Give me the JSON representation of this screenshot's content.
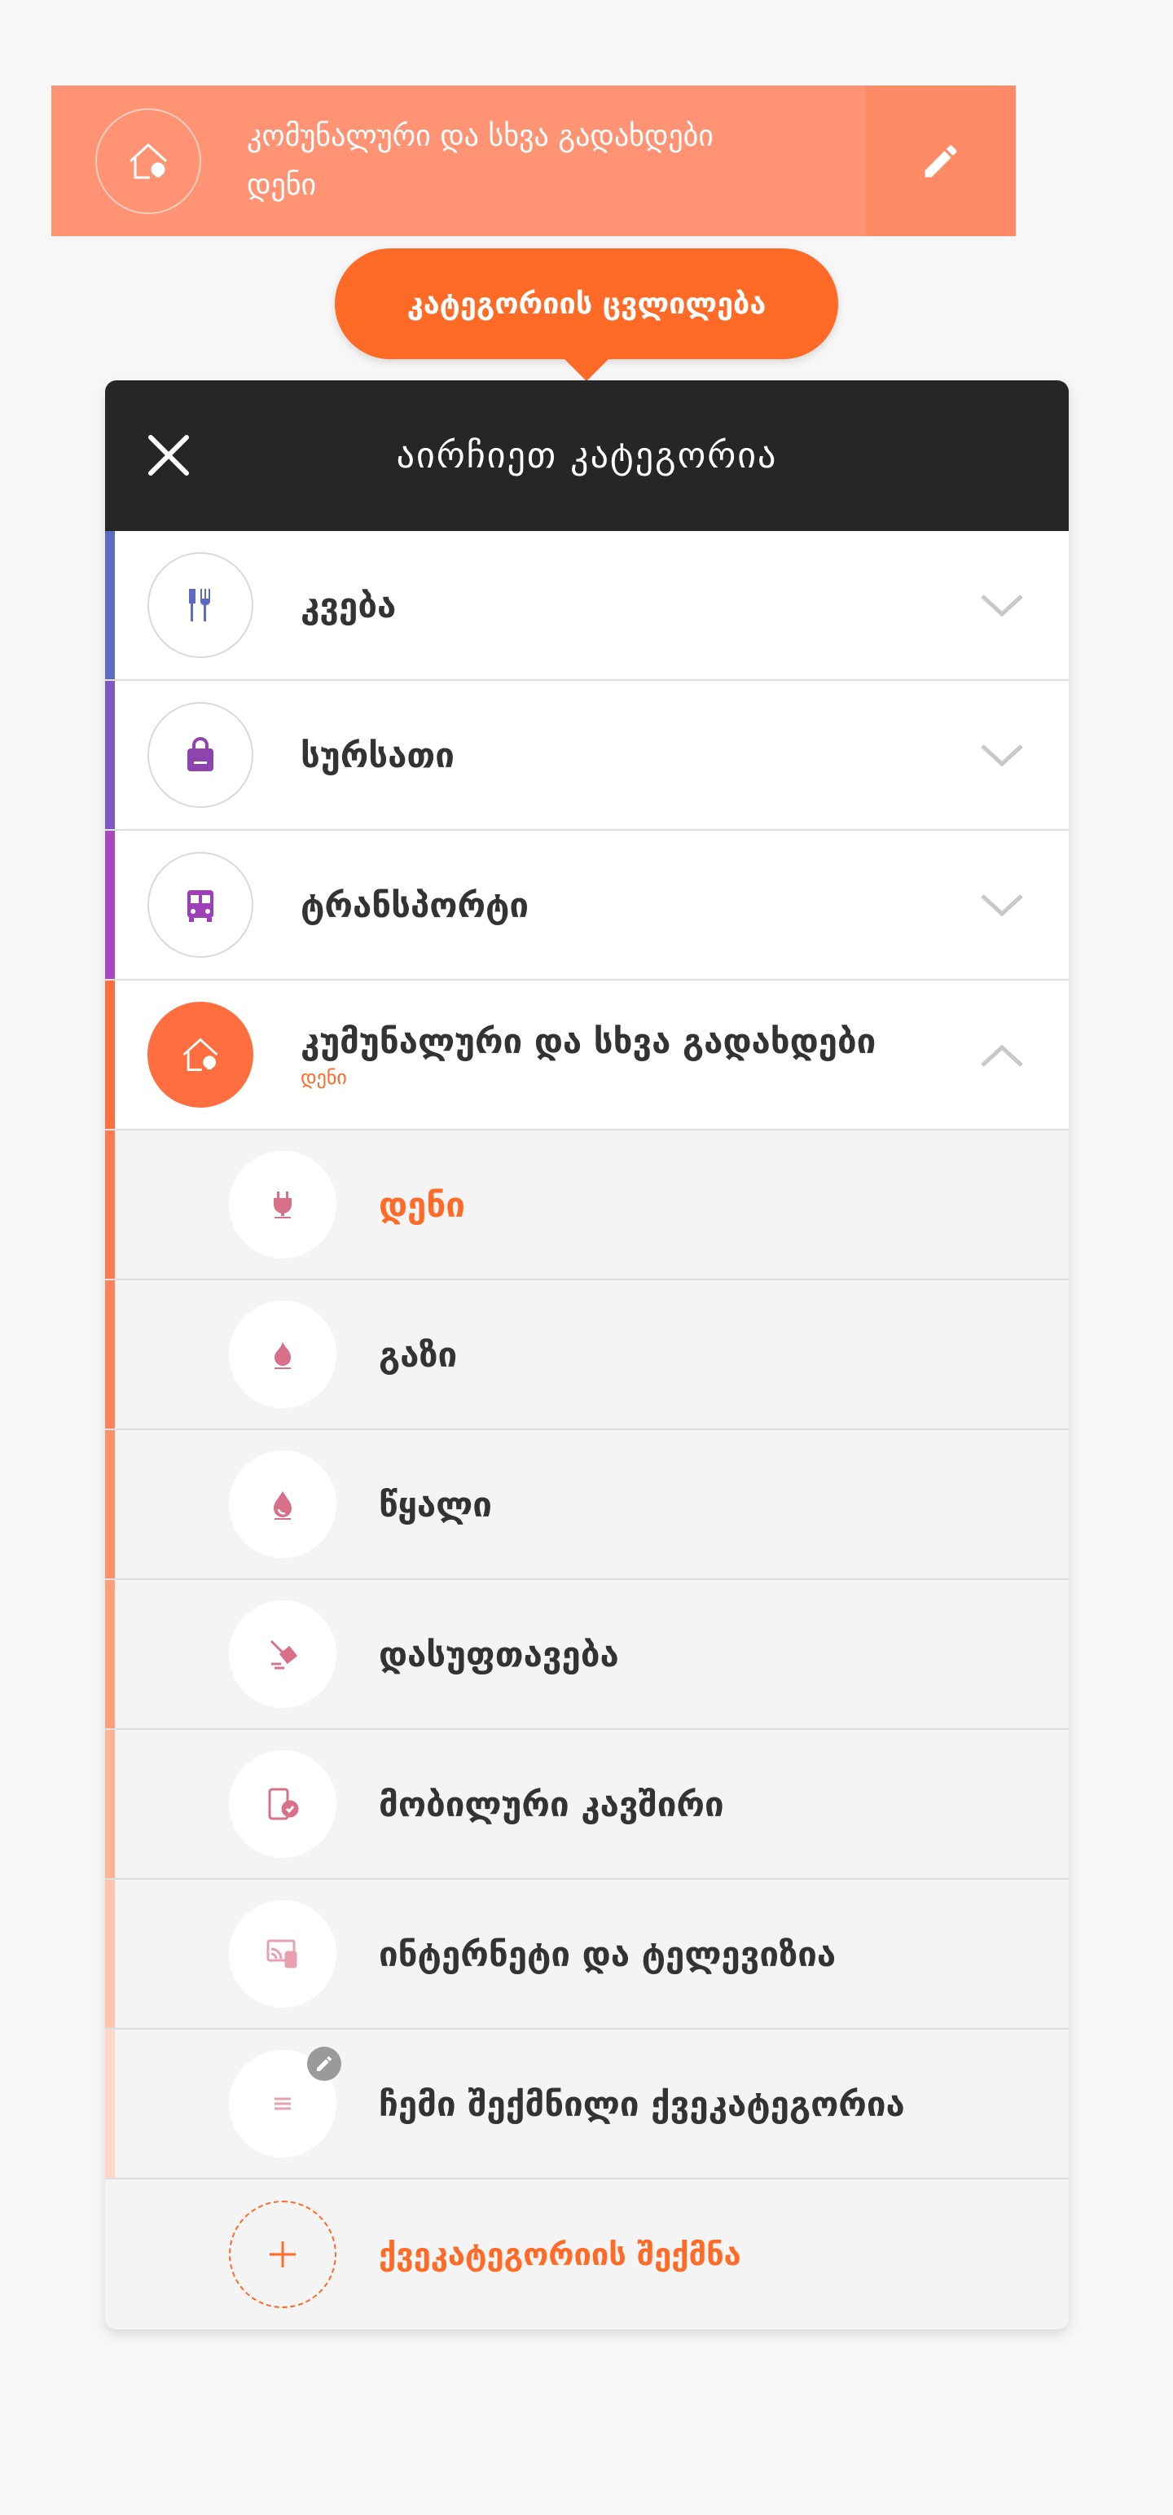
{
  "topbar": {
    "title": "კომუნალური და სხვა გადახდები",
    "subtitle": "დენი",
    "icon": "house-bulb-icon",
    "edit_icon": "pencil-icon",
    "color": "#ff9373"
  },
  "tooltip": {
    "text": "კატეგორიის ცვლილება",
    "color": "#ff6a26"
  },
  "modal": {
    "title": "აირჩიეთ კატეგორია",
    "close_icon": "close-icon",
    "categories": [
      {
        "label": "კვება",
        "icon": "cutlery-icon",
        "color": "#5c6bc0",
        "expanded": false
      },
      {
        "label": "სურსათი",
        "icon": "shopping-bag-icon",
        "color": "#7e57c2",
        "expanded": false
      },
      {
        "label": "ტრანსპორტი",
        "icon": "bus-icon",
        "color": "#ab47bc",
        "expanded": false
      },
      {
        "label": "კუმუნალური და სხვა გადახდები",
        "sub": "დენი",
        "icon": "house-bulb-icon",
        "color": "#ff6e3f",
        "expanded": true
      }
    ],
    "subcategories": [
      {
        "label": "დენი",
        "icon": "plug-icon",
        "selected": true
      },
      {
        "label": "გაზი",
        "icon": "flame-icon",
        "selected": false
      },
      {
        "label": "წყალი",
        "icon": "water-drop-icon",
        "selected": false
      },
      {
        "label": "დასუფთავება",
        "icon": "broom-icon",
        "selected": false
      },
      {
        "label": "მობილური კავშირი",
        "icon": "phone-check-icon",
        "selected": false
      },
      {
        "label": "ინტერნეტი და ტელევიზია",
        "icon": "tv-wifi-icon",
        "selected": false
      },
      {
        "label": "ჩემი შექმნილი ქვეკატეგორია",
        "icon": "list-icon",
        "badge_icon": "pencil-icon",
        "selected": false
      }
    ],
    "add_label": "ქვეკატეგორიის შექმნა",
    "add_icon": "plus-icon",
    "accent": "#ff6a26"
  }
}
